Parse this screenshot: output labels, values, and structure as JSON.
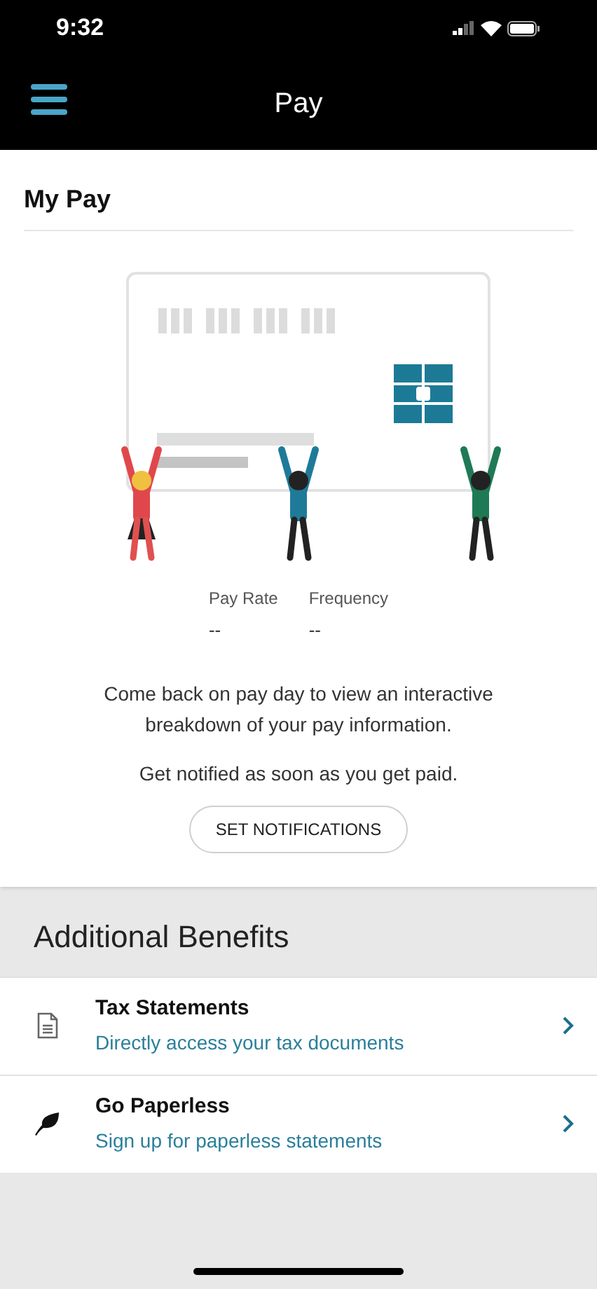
{
  "status_bar": {
    "time": "9:32"
  },
  "header": {
    "title": "Pay"
  },
  "my_pay": {
    "title": "My Pay",
    "stats": [
      {
        "label": "Pay Rate",
        "value": "--"
      },
      {
        "label": "Frequency",
        "value": "--"
      }
    ],
    "message": "Come back on pay day to view an interactive breakdown of your pay information.",
    "notify_text": "Get notified as soon as you get paid.",
    "button": "SET NOTIFICATIONS"
  },
  "additional_benefits": {
    "title": "Additional Benefits",
    "items": [
      {
        "kind": "document",
        "title": "Tax Statements",
        "subtitle": "Directly access your tax documents"
      },
      {
        "kind": "leaf",
        "title": "Go Paperless",
        "subtitle": "Sign up for paperless statements"
      }
    ]
  }
}
